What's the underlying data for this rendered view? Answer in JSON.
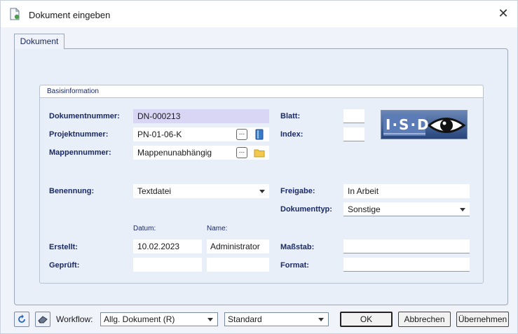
{
  "window": {
    "title": "Dokument eingeben",
    "close_glyph": "✕"
  },
  "tabs": [
    {
      "label": "Dokument"
    }
  ],
  "group": {
    "title": "Basisinformation"
  },
  "labels": {
    "dokumentnummer": "Dokumentnummer:",
    "projektnummer": "Projektnummer:",
    "mappennummer": "Mappennummer:",
    "benennung": "Benennung:",
    "blatt": "Blatt:",
    "index": "Index:",
    "freigabe": "Freigabe:",
    "dokumenttyp": "Dokumenttyp:",
    "datum": "Datum:",
    "name": "Name:",
    "erstellt": "Erstellt:",
    "geprueft": "Geprüft:",
    "massstab": "Maßstab:",
    "format": "Format:"
  },
  "values": {
    "dokumentnummer": "DN-000213",
    "projektnummer": "PN-01-06-K",
    "mappennummer": "Mappenunabhängig",
    "benennung": "Textdatei",
    "blatt": "",
    "index": "",
    "freigabe": "In Arbeit",
    "dokumenttyp": "Sonstige",
    "erstellt_datum": "10.02.2023",
    "erstellt_name": "Administrator",
    "geprueft_datum": "",
    "geprueft_name": "",
    "massstab": "",
    "format": ""
  },
  "dots_label": "...",
  "logo": {
    "text": "I·S·D"
  },
  "footer": {
    "workflow_label": "Workflow:",
    "workflow_value": "Allg. Dokument (R)",
    "standard_value": "Standard",
    "ok": "OK",
    "cancel": "Abbrechen",
    "apply": "Übernehmen"
  },
  "colors": {
    "accent": "#1a2a66",
    "highlight_field": "#d9d6f5",
    "panel": "#e8eff8"
  },
  "icons": {
    "title": "document-icon",
    "project": "book-icon",
    "folder": "folder-icon",
    "refresh": "refresh-icon",
    "tool": "eraser-icon"
  }
}
